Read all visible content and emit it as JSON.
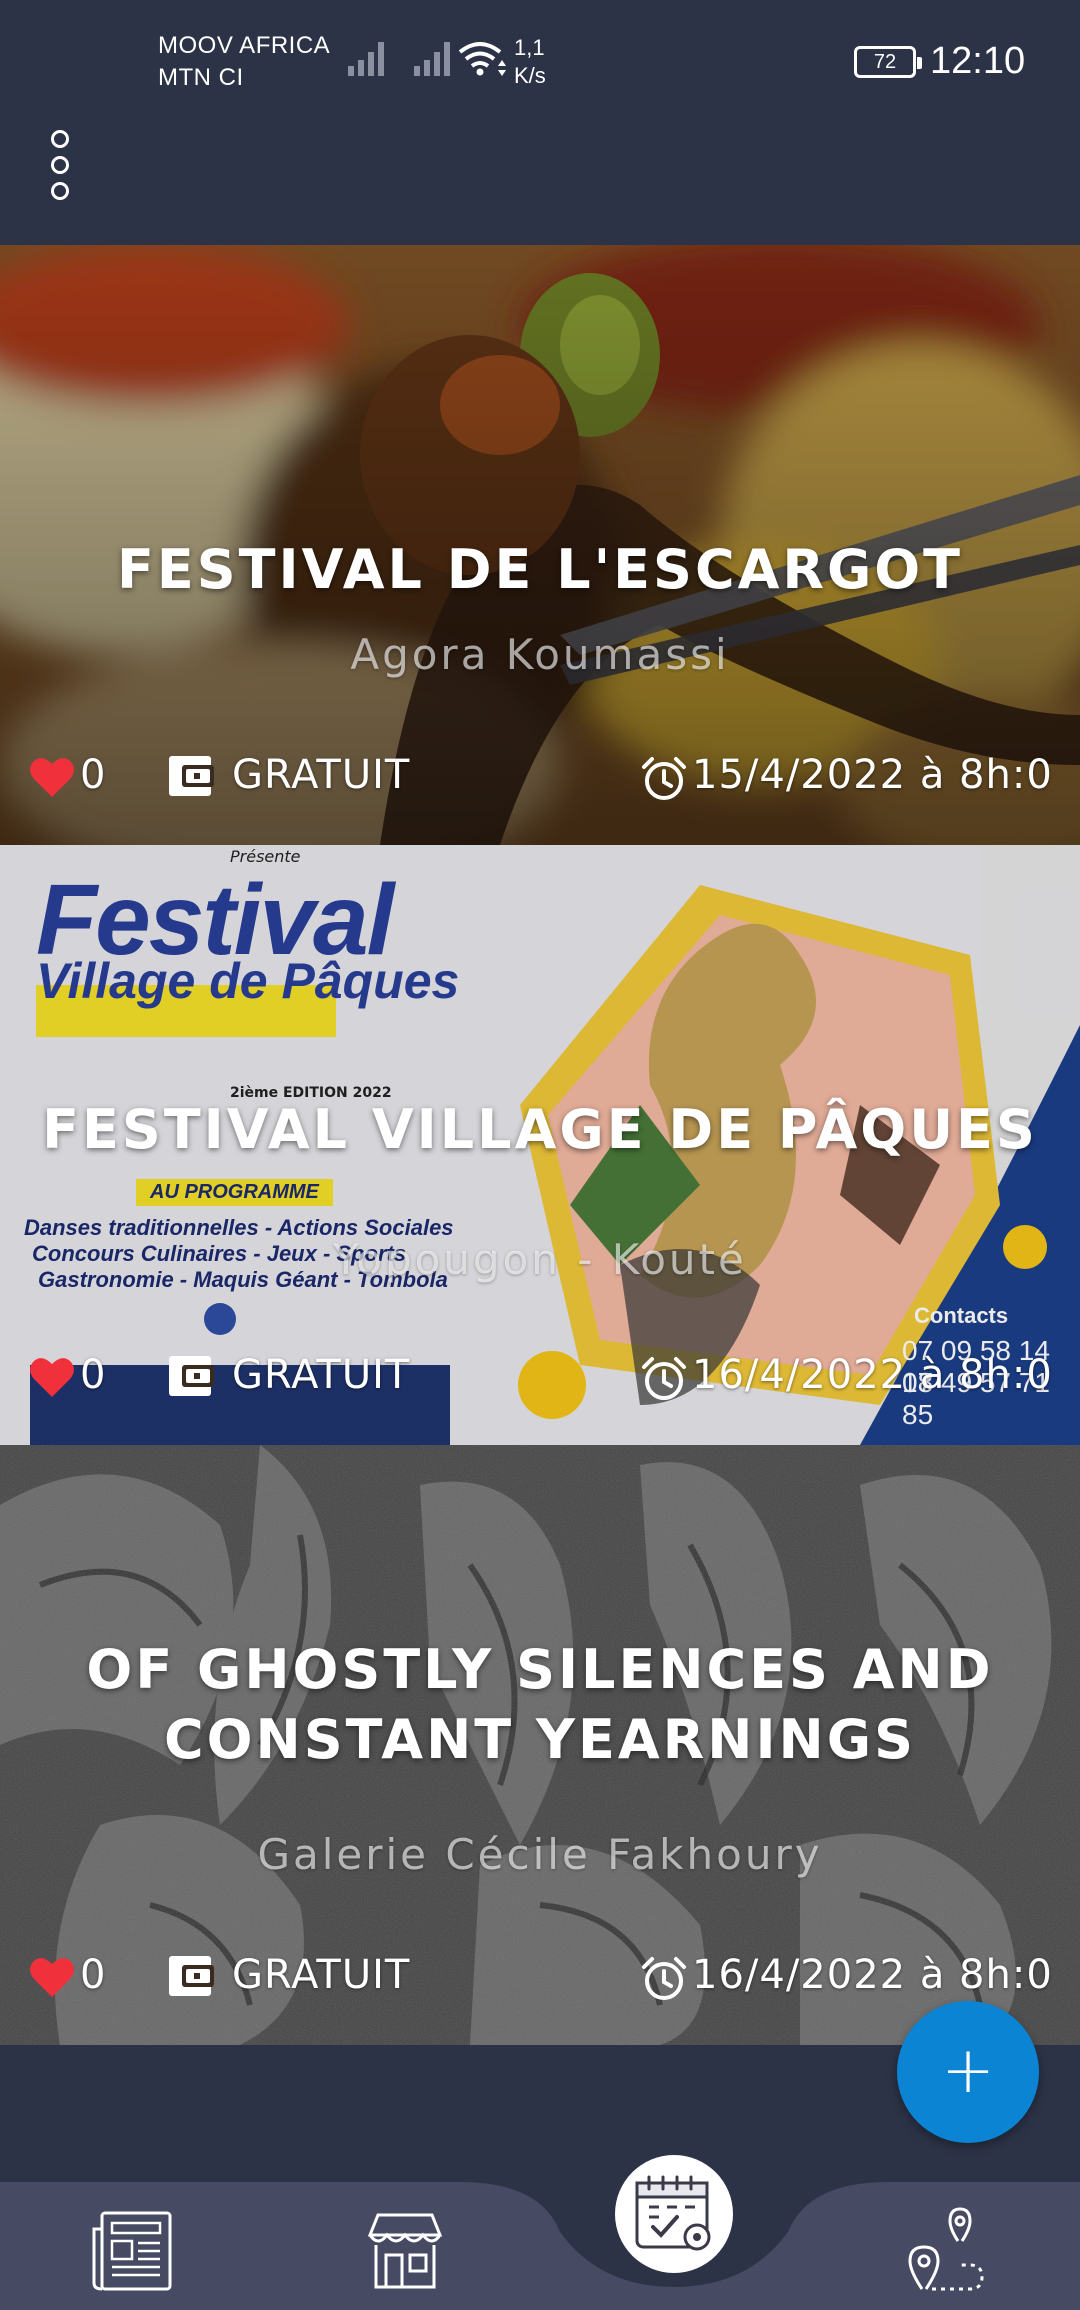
{
  "status_bar": {
    "carrier_1": "MOOV AFRICA",
    "carrier_2": "MTN CI",
    "speed_value": "1,1",
    "speed_unit": "K/s",
    "battery": "72",
    "time": "12:10"
  },
  "toolbar": {
    "menu_icon": "more-vertical-icon"
  },
  "events": [
    {
      "title": "FESTIVAL DE L'ESCARGOT",
      "venue": "Agora Koumassi",
      "likes": "0",
      "price": "GRATUIT",
      "date": "15/4/2022 à 8h:0"
    },
    {
      "title": "FESTIVAL VILLAGE DE PÂQUES",
      "venue": "Yopougon - Kouté",
      "likes": "0",
      "price": "GRATUIT",
      "date": "16/4/2022 à 8h:0",
      "poster": {
        "presente": "Présente",
        "headline": "Festival",
        "subhead": "Village de Pâques",
        "edition": "2ième EDITION 2022",
        "programme": "AU PROGRAMME",
        "line1": "Danses traditionnelles - Actions Sociales",
        "line2": "Concours Culinaires - Jeux - Sports",
        "line3": "Gastronomie - Maquis Géant - Tombola",
        "contacts_label": "Contacts",
        "phone1": "07 09 58 14 18",
        "phone2": "07 49 57 71 85"
      }
    },
    {
      "title": "OF GHOSTLY SILENCES AND CONSTANT YEARNINGS",
      "venue": "Galerie Cécile Fakhoury",
      "likes": "0",
      "price": "GRATUIT",
      "date": "16/4/2022 à 8h:0"
    }
  ],
  "fab": {
    "label": "+"
  },
  "bottom_nav": {
    "items": [
      "news-icon",
      "store-icon",
      "calendar-check-icon",
      "map-route-icon"
    ],
    "active": "calendar-check-icon"
  },
  "colors": {
    "background": "#2c3347",
    "fab": "#0b84d3",
    "heart": "#f0313b",
    "nav_bar": "#474a63"
  }
}
